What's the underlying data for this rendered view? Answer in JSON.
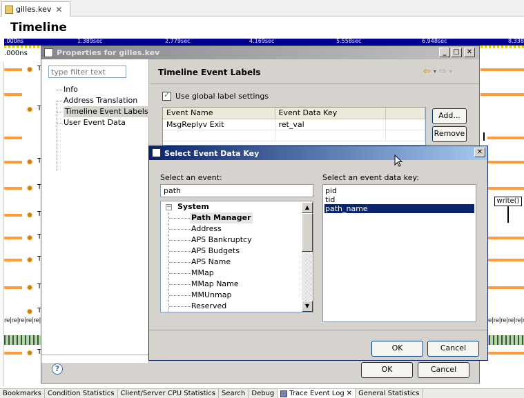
{
  "editor": {
    "tab_label": "gilles.kev",
    "tab_close": "✕",
    "title": "Timeline",
    "ruler_labels": [
      ".000ns",
      "1.389sec",
      "2.779sec",
      "4.169sec",
      "5.558sec",
      "6.948sec",
      "8.338"
    ],
    "sub_ruler_label": ".000ns",
    "row_T": "T",
    "re_strip": "re|re|re|re|re|re",
    "re_strip_right": "re|re|re|re|re|re",
    "write_label": "write()"
  },
  "bottom_tabs": [
    "Bookmarks",
    "Condition Statistics",
    "Client/Server CPU Statistics",
    "Search",
    "Debug",
    "Trace Event Log",
    "General Statistics"
  ],
  "bottom_active_close": "✕",
  "properties": {
    "title": "Properties for gilles.kev",
    "window_buttons": [
      "_",
      "□",
      "✕"
    ],
    "filter_placeholder": "type filter text",
    "tree_items": [
      "Info",
      "Address Translation",
      "Timeline Event Labels",
      "User Event Data"
    ],
    "page_title": "Timeline Event Labels",
    "checkbox_label": "Use global label settings",
    "table_columns": [
      "Event Name",
      "Event Data Key",
      ""
    ],
    "table_rows": [
      [
        "MsgReplyv Exit",
        "ret_val",
        ""
      ]
    ],
    "add_button": "Add...",
    "remove_button": "Remove",
    "ok_button": "OK",
    "cancel_button": "Cancel",
    "help": "?"
  },
  "select_dialog": {
    "title": "Select Event Data Key",
    "close": "✕",
    "event_label": "Select an event:",
    "search_value": "path",
    "tree": {
      "root": "System",
      "expander": "−",
      "children": [
        "Path Manager",
        "Address",
        "APS Bankruptcy",
        "APS Budgets",
        "APS Name",
        "MMap",
        "MMap Name",
        "MMUnmap",
        "Reserved"
      ]
    },
    "key_label": "Select an event data key:",
    "keys": [
      "pid",
      "tid",
      "path_name"
    ],
    "selected_key": "path_name",
    "ok_button": "OK",
    "cancel_button": "Cancel"
  },
  "colors": {
    "ruler": "#00008e",
    "timeline_line": "#ff9d3c",
    "selection": "#0a246a"
  }
}
